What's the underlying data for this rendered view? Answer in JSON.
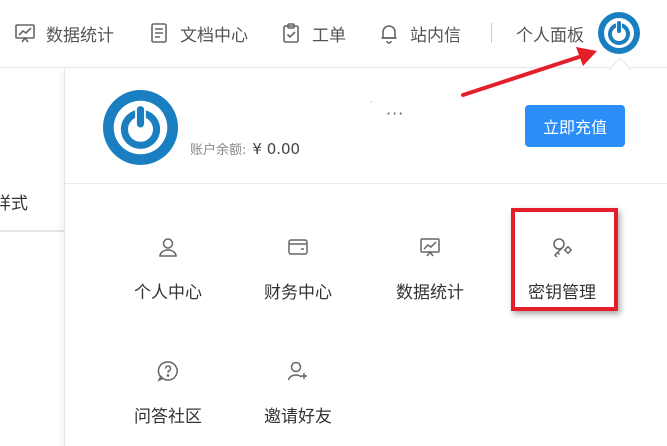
{
  "topbar": {
    "nav": [
      {
        "label": "数据统计",
        "icon": "chart-board-icon"
      },
      {
        "label": "文档中心",
        "icon": "document-icon"
      },
      {
        "label": "工单",
        "icon": "clipboard-check-icon"
      },
      {
        "label": "站内信",
        "icon": "bell-icon"
      }
    ],
    "personal_label": "个人面板",
    "avatar_icon": "power-logo-icon"
  },
  "left_panel": {
    "partial_text": "样式"
  },
  "dropdown": {
    "username": "·",
    "more": "···",
    "balance_label": "账户余额:",
    "balance_value": "¥  0.00",
    "recharge_label": "立即充值",
    "menu": [
      {
        "label": "个人中心",
        "icon": "user-icon"
      },
      {
        "label": "财务中心",
        "icon": "wallet-icon"
      },
      {
        "label": "数据统计",
        "icon": "chart-board-icon"
      },
      {
        "label": "密钥管理",
        "icon": "key-gear-icon"
      },
      {
        "label": "问答社区",
        "icon": "question-bubble-icon"
      },
      {
        "label": "邀请好友",
        "icon": "add-user-icon"
      }
    ]
  },
  "colors": {
    "accent": "#2b8ef7",
    "annotation": "#e3202a",
    "logo_blue": "#1a7fc1"
  }
}
